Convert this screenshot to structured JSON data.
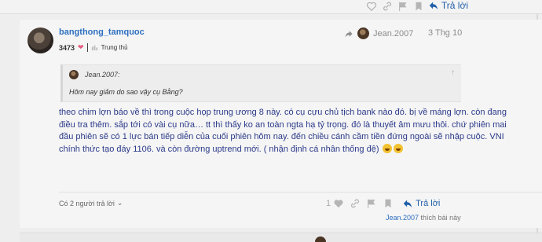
{
  "prev_post": {
    "reply_label": "Trả lời"
  },
  "post": {
    "username": "bangthong_tamquoc",
    "count": "3473",
    "title": "Trung thủ",
    "reply_to_user": "Jean.2007",
    "date": "3 Thg 10",
    "quote": {
      "user": "Jean.2007:",
      "text": "Hôm nay giảm do sao vậy cụ Bằng?"
    },
    "body": "theo chim lợn báo về thì trong cuộc họp trung ương 8 này. có cụ cựu chủ tịch bank nào đó. bị về máng lợn. còn đang điều tra thêm. sắp tới có vài cụ nữa… tt thì thấy ko an toàn ngta hạ tỷ trọng. đó là thuyết âm mưu thôi. chứ phiên mai đầu phiên sẽ có 1 lực bán tiếp diễn của cuối phiên hôm nay. đến chiều cánh cầm tiền đứng ngoài sẽ nhập cuộc. VNI chính thức tạo đáy 1106. và còn đường uptrend mới. ( nhận định cá nhân thống đệ)",
    "replies_label": "Có 2 người trả lời",
    "like_count": "1",
    "reply_label": "Trả lời",
    "liked_by_user": "Jean.2007",
    "liked_by_suffix": " thích bài này"
  },
  "icons": [
    "heart-icon",
    "link-icon",
    "flag-icon",
    "bookmark-icon",
    "reply-icon",
    "chevron-down-icon",
    "share-arrow-icon"
  ],
  "colors": {
    "link": "#2d6fc0",
    "reply": "#1f5ea8",
    "body_text": "#2b3a8a",
    "heart": "#e45a7b"
  }
}
